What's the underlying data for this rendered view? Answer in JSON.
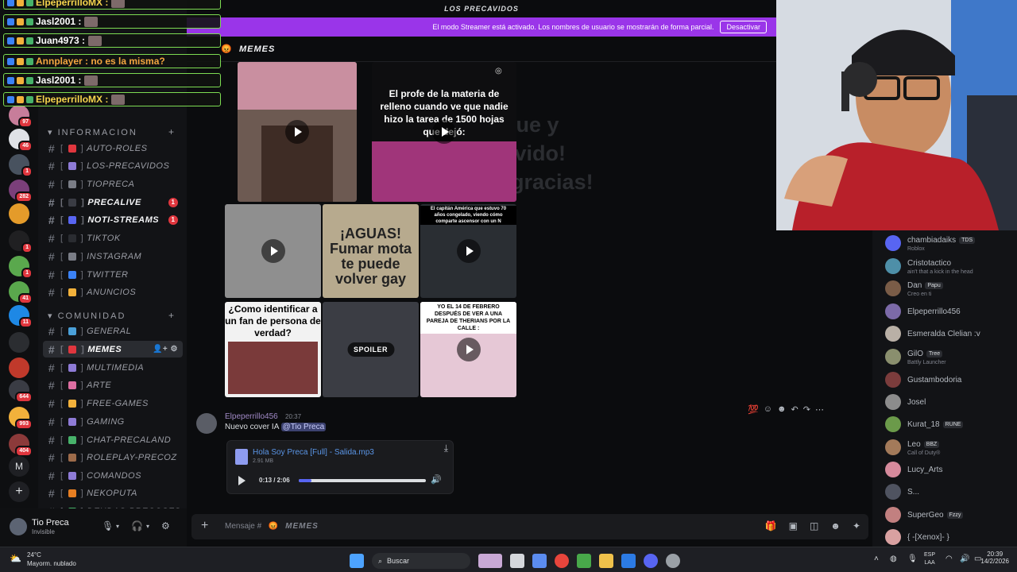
{
  "window": {
    "server_title": "LOS PRECAVIDOS"
  },
  "streamer_banner": {
    "text": "El modo Streamer está activado. Los nombres de usuario se mostrarán de forma parcial.",
    "button": "Desactivar"
  },
  "channel_header": {
    "name": "MEMES"
  },
  "rail": {
    "badges": [
      "97",
      "46",
      "1",
      "282",
      "1",
      "1",
      "41",
      "11",
      "644",
      "993",
      "404"
    ]
  },
  "sidebar": {
    "categories": [
      {
        "label": "INFORMACION"
      },
      {
        "label": "COMUNIDAD"
      }
    ],
    "channels": [
      {
        "label": "AUTO-ROLES",
        "unread": ""
      },
      {
        "label": "LOS-PRECAVIDOS",
        "unread": ""
      },
      {
        "label": "TIOPRECA",
        "unread": ""
      },
      {
        "label": "PRECALIVE",
        "unread": "1"
      },
      {
        "label": "NOTI-STREAMS",
        "unread": "1"
      },
      {
        "label": "TIKTOK",
        "unread": ""
      },
      {
        "label": "INSTAGRAM",
        "unread": ""
      },
      {
        "label": "TWITTER",
        "unread": ""
      },
      {
        "label": "ANUNCIOS",
        "unread": ""
      },
      {
        "label": "GENERAL",
        "unread": ""
      },
      {
        "label": "MEMES",
        "unread": ""
      },
      {
        "label": "MULTIMEDIA",
        "unread": ""
      },
      {
        "label": "ARTE",
        "unread": ""
      },
      {
        "label": "FREE-GAMES",
        "unread": ""
      },
      {
        "label": "GAMING",
        "unread": ""
      },
      {
        "label": "CHAT-PRECALAND",
        "unread": ""
      },
      {
        "label": "ROLEPLAY-PRECOZ",
        "unread": ""
      },
      {
        "label": "COMANDOS",
        "unread": ""
      },
      {
        "label": "NEKOPUTA",
        "unread": ""
      },
      {
        "label": "DEUDAS-PRECOSES",
        "unread": ""
      }
    ]
  },
  "user_panel": {
    "name": "Tio Preca",
    "status": "Invisible"
  },
  "chat": {
    "background_text": [
      "nos sigue y",
      "un precavido!",
      "Muchas gracias!"
    ],
    "media": {
      "meme_prof": "El profe de la materia de relleno cuando ve que nadie hizo la tarea de 1500 hojas que dejó:",
      "meme_fumar": "¡AGUAS! Fumar mota te puede volver gay",
      "meme_capitan": "El capitán América que estuvo 70 años congelado, viendo cómo comparte ascensor con un N",
      "meme_fan": "¿Como identificar a un fan de persona de verdad?",
      "spoiler": "SPOILER",
      "meme_therians": "YO EL 14 DE FEBRERO DESPUÉS DE VER A UNA PAREJA DE THERIANS POR LA CALLE :"
    },
    "message": {
      "author": "Elpeperrillo456",
      "time": "20:37",
      "text": "Nuevo cover IA",
      "mention": "@Tio Preca",
      "attachment": {
        "filename": "Hola Soy Preca [Full] - Salida.mp3",
        "size": "2.91 MB",
        "time": "0:13 / 2:06",
        "progress": 0.103
      }
    }
  },
  "composer": {
    "placeholder_prefix": "Mensaje #",
    "channel": "MEMES"
  },
  "members": [
    {
      "name": "chambiadaiks",
      "tag": "TDS",
      "sub": "Roblox",
      "color": "#5865f2"
    },
    {
      "name": "Cristotactico",
      "tag": "",
      "sub": "ain't that a kick in the head",
      "color": "#4e8fa8"
    },
    {
      "name": "Dan",
      "tag": "Papu",
      "sub": "Creo en ti",
      "color": "#7a5c47"
    },
    {
      "name": "Elpeperrillo456",
      "tag": "",
      "sub": "",
      "color": "#7c6aa8"
    },
    {
      "name": "Esmeralda Clelian :v",
      "tag": "",
      "sub": "",
      "color": "#b9b0a6"
    },
    {
      "name": "GilO",
      "tag": "Tree",
      "sub": "Battly Launcher",
      "color": "#8a8f6e"
    },
    {
      "name": "Gustambodoria",
      "tag": "",
      "sub": "",
      "color": "#7b3c3c"
    },
    {
      "name": "Josel",
      "tag": "",
      "sub": "",
      "color": "#8c8c8c"
    },
    {
      "name": "Kurat_18",
      "tag": "RUNE",
      "sub": "",
      "color": "#6b9a4a"
    },
    {
      "name": "Leo",
      "tag": "BBZ",
      "sub": "Call of Duty®",
      "color": "#a37a5a"
    },
    {
      "name": "Lucy_Arts",
      "tag": "",
      "sub": "",
      "color": "#d68a9c"
    },
    {
      "name": "S...",
      "tag": "",
      "sub": "",
      "color": "#4f5360"
    },
    {
      "name": "SuperGeo",
      "tag": "Fzzy",
      "sub": "",
      "color": "#c28080"
    },
    {
      "name": "{ -[Xenox]- }",
      "tag": "",
      "sub": "",
      "color": "#d9a1a1"
    }
  ],
  "overlay_chat": [
    {
      "text": "ElpeperrilloMX :",
      "color": "#f6d44d",
      "thumb": true
    },
    {
      "text": "Jasl2001 :",
      "color": "#ffffff",
      "thumb": true
    },
    {
      "text": "Juan4973 :",
      "color": "#ffffff",
      "thumb": true
    },
    {
      "text": "Annplayer : no es la misma?",
      "color": "#f4a640",
      "thumb": false
    },
    {
      "text": "Jasl2001 :",
      "color": "#ffffff",
      "thumb": true
    },
    {
      "text": "ElpeperrilloMX :",
      "color": "#f6d44d",
      "thumb": true
    }
  ],
  "taskbar": {
    "temp": "24°C",
    "weather": "Mayorm. nublado",
    "search": "Buscar",
    "lang_top": "ESP",
    "lang_bottom": "LAA",
    "time": "20:39",
    "date": "14/2/2026"
  }
}
